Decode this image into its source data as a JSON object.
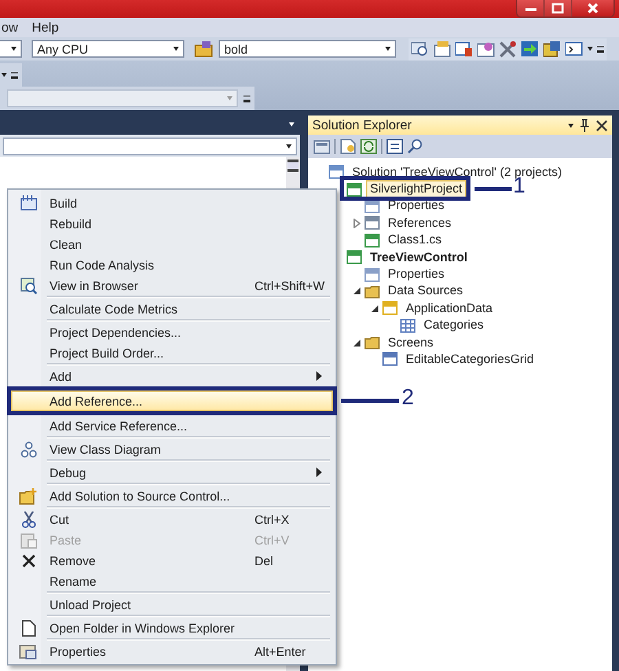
{
  "menu_bar": {
    "items": [
      "ow",
      "Help"
    ]
  },
  "toolbar": {
    "platform": "Any CPU",
    "find": "bold"
  },
  "solution_explorer": {
    "title": "Solution Explorer",
    "tree": [
      {
        "label": "Solution 'TreeViewControl' (2 projects)",
        "kind": "solution",
        "bold": false,
        "selected": false,
        "children": [
          {
            "label": "SilverlightProject",
            "kind": "project",
            "bold": false,
            "selected": true,
            "children": [
              {
                "label": "Properties",
                "kind": "properties",
                "bold": false,
                "selected": false
              },
              {
                "label": "References",
                "kind": "references",
                "bold": false,
                "selected": false,
                "expanded": false
              },
              {
                "label": "Class1.cs",
                "kind": "file",
                "bold": false,
                "selected": false
              }
            ]
          },
          {
            "label": "TreeViewControl",
            "kind": "project",
            "bold": true,
            "selected": false,
            "children": [
              {
                "label": "Properties",
                "kind": "properties",
                "bold": false,
                "selected": false
              },
              {
                "label": "Data Sources",
                "kind": "folder",
                "bold": false,
                "selected": false,
                "expanded": true,
                "children": [
                  {
                    "label": "ApplicationData",
                    "kind": "data",
                    "bold": false,
                    "selected": false,
                    "expanded": true,
                    "children": [
                      {
                        "label": "Categories",
                        "kind": "table",
                        "bold": false,
                        "selected": false
                      }
                    ]
                  }
                ]
              },
              {
                "label": "Screens",
                "kind": "folder",
                "bold": false,
                "selected": false,
                "expanded": true,
                "children": [
                  {
                    "label": "EditableCategoriesGrid",
                    "kind": "screen",
                    "bold": false,
                    "selected": false
                  }
                ]
              }
            ]
          }
        ]
      }
    ]
  },
  "context_menu": {
    "groups": [
      [
        {
          "label": "Build",
          "kind": "build",
          "selected": false,
          "disabled": false
        },
        {
          "label": "Rebuild",
          "selected": false,
          "disabled": false
        },
        {
          "label": "Clean",
          "selected": false,
          "disabled": false
        },
        {
          "label": "Run Code Analysis",
          "selected": false,
          "disabled": false
        },
        {
          "label": "View in Browser",
          "kind": "browser",
          "shortcut": "Ctrl+Shift+W",
          "selected": false,
          "disabled": false
        }
      ],
      [
        {
          "label": "Calculate Code Metrics",
          "selected": false,
          "disabled": false
        }
      ],
      [
        {
          "label": "Project Dependencies...",
          "selected": false,
          "disabled": false
        },
        {
          "label": "Project Build Order...",
          "selected": false,
          "disabled": false
        }
      ],
      [
        {
          "label": "Add",
          "submenu": true,
          "selected": false,
          "disabled": false
        },
        {
          "label": "Add Reference...",
          "selected": true,
          "disabled": false
        },
        {
          "label": "Add Service Reference...",
          "selected": false,
          "disabled": false
        }
      ],
      [
        {
          "label": "View Class Diagram",
          "kind": "diagram",
          "selected": false,
          "disabled": false
        }
      ],
      [
        {
          "label": "Debug",
          "submenu": true,
          "selected": false,
          "disabled": false
        }
      ],
      [
        {
          "label": "Add Solution to Source Control...",
          "kind": "folder",
          "selected": false,
          "disabled": false
        }
      ],
      [
        {
          "label": "Cut",
          "kind": "cut",
          "shortcut": "Ctrl+X",
          "selected": false,
          "disabled": false
        },
        {
          "label": "Paste",
          "kind": "paste",
          "shortcut": "Ctrl+V",
          "selected": false,
          "disabled": true
        },
        {
          "label": "Remove",
          "kind": "remove",
          "shortcut": "Del",
          "selected": false,
          "disabled": false
        },
        {
          "label": "Rename",
          "selected": false,
          "disabled": false
        }
      ],
      [
        {
          "label": "Unload Project",
          "selected": false,
          "disabled": false
        }
      ],
      [
        {
          "label": "Open Folder in Windows Explorer",
          "kind": "page",
          "selected": false,
          "disabled": false
        }
      ],
      [
        {
          "label": "Properties",
          "kind": "properties",
          "shortcut": "Alt+Enter",
          "selected": false,
          "disabled": false
        }
      ]
    ]
  },
  "callouts": [
    {
      "label": "1"
    },
    {
      "label": "2"
    }
  ]
}
